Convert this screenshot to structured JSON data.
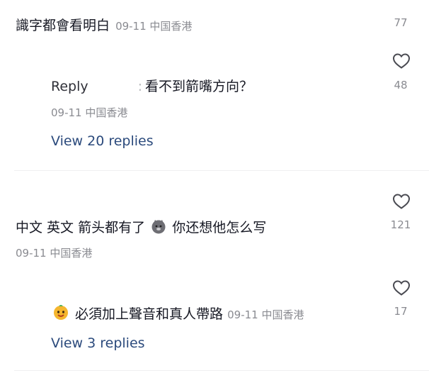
{
  "comment1": {
    "text": "識字都會看明白",
    "meta": "09-11 中国香港",
    "likes": "77"
  },
  "reply1": {
    "label": "Reply",
    "sep": ":",
    "text": "看不到箭嘴方向？",
    "meta": "09-11 中国香港",
    "likes": "48",
    "view_replies": "View 20 replies"
  },
  "comment2": {
    "text_a": "中文 英文 箭头都有了",
    "text_b": "你还想他怎么写",
    "meta": "09-11 中国香港",
    "likes": "121"
  },
  "reply2": {
    "text": "必須加上聲音和真人帶路",
    "meta": "09-11 中国香港",
    "likes": "17",
    "view_replies": "View 3 replies"
  }
}
